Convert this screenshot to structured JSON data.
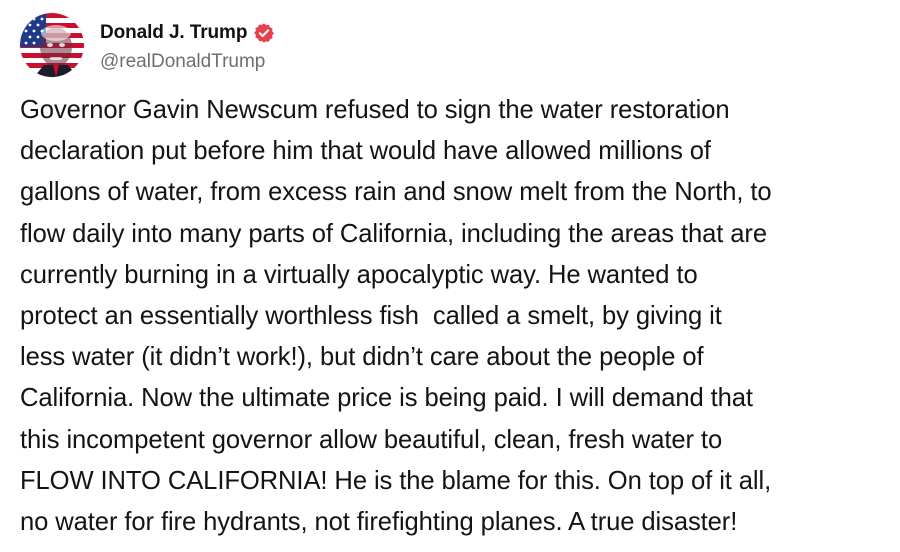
{
  "author": {
    "display_name": "Donald J. Trump",
    "handle": "@realDonaldTrump",
    "verified_color": "#e8414e",
    "avatar_icon": "avatar-flag-portrait"
  },
  "post": {
    "text": "Governor Gavin Newscum refused to sign the water restoration\ndeclaration put before him that would have allowed millions of\ngallons of water, from excess rain and snow melt from the North, to\nflow daily into many parts of California, including the areas that are\ncurrently burning in a virtually apocalyptic way. He wanted to\nprotect an essentially worthless fish  called a smelt, by giving it\nless water (it didn’t work!), but didn’t care about the people of\nCalifornia. Now the ultimate price is being paid. I will demand that\nthis incompetent governor allow beautiful, clean, fresh water to\nFLOW INTO CALIFORNIA! He is the blame for this. On top of it all,\nno water for fire hydrants, not firefighting planes. A true disaster!"
  }
}
